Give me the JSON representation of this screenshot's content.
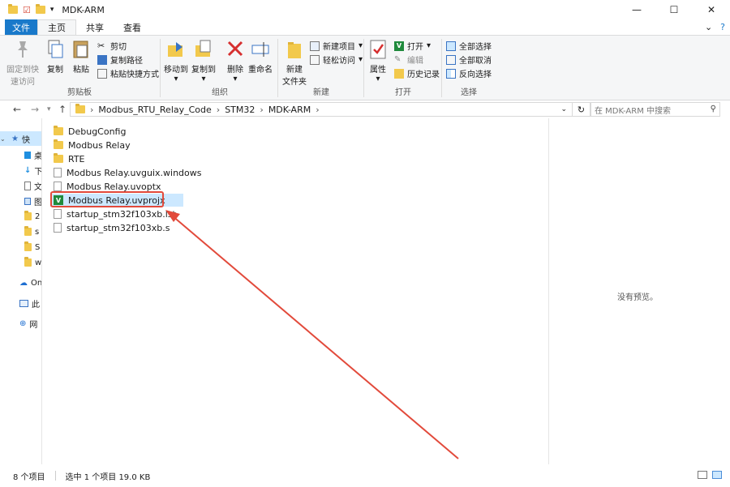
{
  "window": {
    "title": "MDK-ARM"
  },
  "tabs": {
    "file": "文件",
    "home": "主页",
    "share": "共享",
    "view": "查看"
  },
  "ribbon": {
    "clipboard": {
      "pin_line1": "固定到快",
      "pin_line2": "速访问",
      "copy": "复制",
      "paste": "粘贴",
      "cut": "剪切",
      "copy_path": "复制路径",
      "paste_shortcut": "粘贴快捷方式",
      "label": "剪贴板"
    },
    "organize": {
      "move_to": "移动到",
      "copy_to": "复制到",
      "delete": "删除",
      "rename": "重命名",
      "label": "组织"
    },
    "new": {
      "new_folder_line1": "新建",
      "new_folder_line2": "文件夹",
      "new_item": "新建项目",
      "easy_access": "轻松访问",
      "label": "新建"
    },
    "open": {
      "properties": "属性",
      "open": "打开",
      "edit": "编辑",
      "history": "历史记录",
      "label": "打开"
    },
    "select": {
      "select_all": "全部选择",
      "select_none": "全部取消",
      "invert": "反向选择",
      "label": "选择"
    }
  },
  "address": {
    "breadcrumbs": [
      "Modbus_RTU_Relay_Code",
      "STM32",
      "MDK-ARM"
    ],
    "search_placeholder": "在 MDK-ARM 中搜索"
  },
  "nav": {
    "items": [
      {
        "label": "快",
        "icon": "star-icon",
        "selected": true
      },
      {
        "label": "桌",
        "icon": "desktop-icon"
      },
      {
        "label": "下",
        "icon": "download-icon"
      },
      {
        "label": "文",
        "icon": "document-icon"
      },
      {
        "label": "图",
        "icon": "picture-icon"
      },
      {
        "label": "2",
        "icon": "folder-icon"
      },
      {
        "label": "s",
        "icon": "folder-icon"
      },
      {
        "label": "S",
        "icon": "folder-icon"
      },
      {
        "label": "w",
        "icon": "folder-icon"
      },
      {
        "label": "On",
        "icon": "cloud-icon"
      },
      {
        "label": "此",
        "icon": "computer-icon"
      },
      {
        "label": "网",
        "icon": "network-icon"
      }
    ]
  },
  "files": [
    {
      "name": "DebugConfig",
      "type": "folder"
    },
    {
      "name": "Modbus Relay",
      "type": "folder"
    },
    {
      "name": "RTE",
      "type": "folder"
    },
    {
      "name": "Modbus Relay.uvguix.windows",
      "type": "file"
    },
    {
      "name": "Modbus Relay.uvoptx",
      "type": "file"
    },
    {
      "name": "Modbus Relay.uvprojx",
      "type": "project",
      "selected": true
    },
    {
      "name": "startup_stm32f103xb.lst",
      "type": "file"
    },
    {
      "name": "startup_stm32f103xb.s",
      "type": "file"
    }
  ],
  "preview": {
    "text": "没有预览。"
  },
  "status": {
    "count": "8 个项目",
    "selection": "选中 1 个项目  19.0 KB"
  },
  "colors": {
    "accent": "#1979ca",
    "selection": "#cce8ff",
    "annotation": "#e24a3b"
  }
}
